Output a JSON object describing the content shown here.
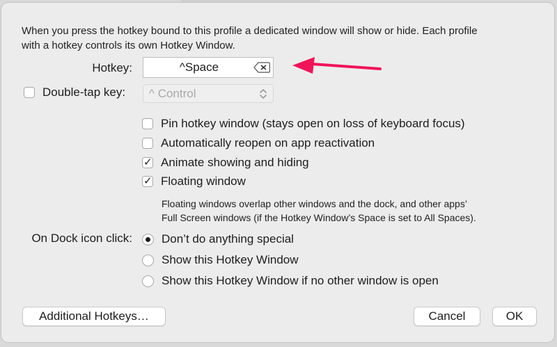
{
  "intro": {
    "line1": "When you press the hotkey bound to this profile a dedicated window will show or hide. Each profile",
    "line2": "with a hotkey controls its own Hotkey Window."
  },
  "hotkey": {
    "label": "Hotkey:",
    "value": "^Space"
  },
  "double_tap": {
    "label": "Double-tap key:",
    "checked": false,
    "select_value": "^ Control"
  },
  "options": [
    {
      "label": "Pin hotkey window (stays open on loss of keyboard focus)",
      "checked": false
    },
    {
      "label": "Automatically reopen on app reactivation",
      "checked": false
    },
    {
      "label": "Animate showing and hiding",
      "checked": true
    },
    {
      "label": "Floating window",
      "checked": true
    }
  ],
  "floating_note": {
    "line1": "Floating windows overlap other windows and the dock, and other apps’",
    "line2": "Full Screen windows (if the Hotkey Window’s Space is set to All Spaces)."
  },
  "dock_click": {
    "label": "On Dock icon click:",
    "choices": [
      {
        "label": "Don’t do anything special",
        "selected": true
      },
      {
        "label": "Show this Hotkey Window",
        "selected": false
      },
      {
        "label": "Show this Hotkey Window if no other window is open",
        "selected": false
      }
    ]
  },
  "buttons": {
    "additional": "Additional Hotkeys…",
    "cancel": "Cancel",
    "ok": "OK"
  },
  "icons": {
    "clear": "delete-backward-icon",
    "chevron": "up-down-chevron-icon",
    "arrow": "annotation-arrow-icon"
  },
  "colors": {
    "arrow": "#f0145a",
    "window_bg": "#ececec"
  }
}
